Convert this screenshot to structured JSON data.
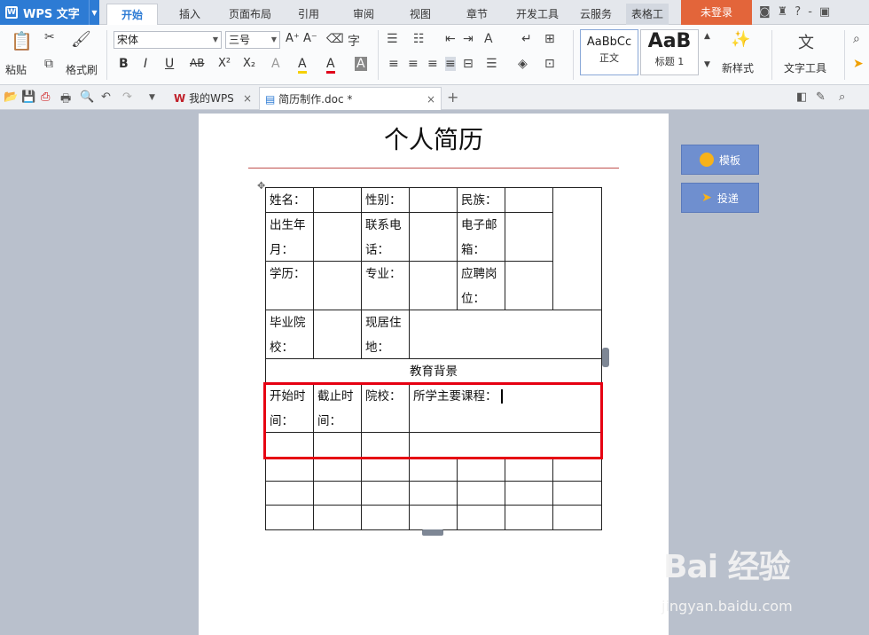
{
  "app": {
    "name": "WPS 文字",
    "logo_glyph": "W"
  },
  "menu_tabs": [
    "开始",
    "插入",
    "页面布局",
    "引用",
    "审阅",
    "视图",
    "章节",
    "开发工具",
    "云服务",
    "表格工"
  ],
  "login_button": "未登录",
  "top_icons": [
    "◙",
    "♜",
    "?",
    "-",
    "▣"
  ],
  "ribbon": {
    "paste_label": "粘贴",
    "format_painter_label": "格式刷",
    "font_name": "宋体",
    "font_size": "三号",
    "style_samples": [
      {
        "sample": "AaBbCc",
        "label": "正文"
      },
      {
        "sample": "AaB",
        "label": "标题 1"
      }
    ],
    "new_style_label": "新样式",
    "text_tools_label": "文字工具",
    "format_buttons": [
      "B",
      "I",
      "U",
      "AB",
      "X²",
      "X₂",
      "A",
      "A",
      "A"
    ],
    "font_grow": "A⁺",
    "font_shrink": "A⁻"
  },
  "doc_tabs": [
    {
      "label": "我的WPS",
      "active": false
    },
    {
      "label": "简历制作.doc *",
      "active": true
    }
  ],
  "document": {
    "title": "个人简历",
    "rows": {
      "r1": [
        "姓名：",
        "性别：",
        "民族："
      ],
      "r2": [
        "出生年月：",
        "联系电话：",
        "电子邮箱："
      ],
      "r3": [
        "学历：",
        "专业：",
        "应聘岗位："
      ],
      "r4": [
        "毕业院校：",
        "现居住地："
      ],
      "section": "教育背景",
      "r6": [
        "开始时间：",
        "截止时间：",
        "院校：",
        "所学主要课程："
      ]
    }
  },
  "side_buttons": {
    "template": "模板",
    "deliver": "投递"
  },
  "watermark": {
    "brand": "Bai 经验",
    "url": "jingyan.baidu.com"
  },
  "colors": {
    "accent": "#2d7bd4",
    "highlight": "#e60012",
    "title_rule": "#c0504d",
    "login": "#e3653a"
  }
}
